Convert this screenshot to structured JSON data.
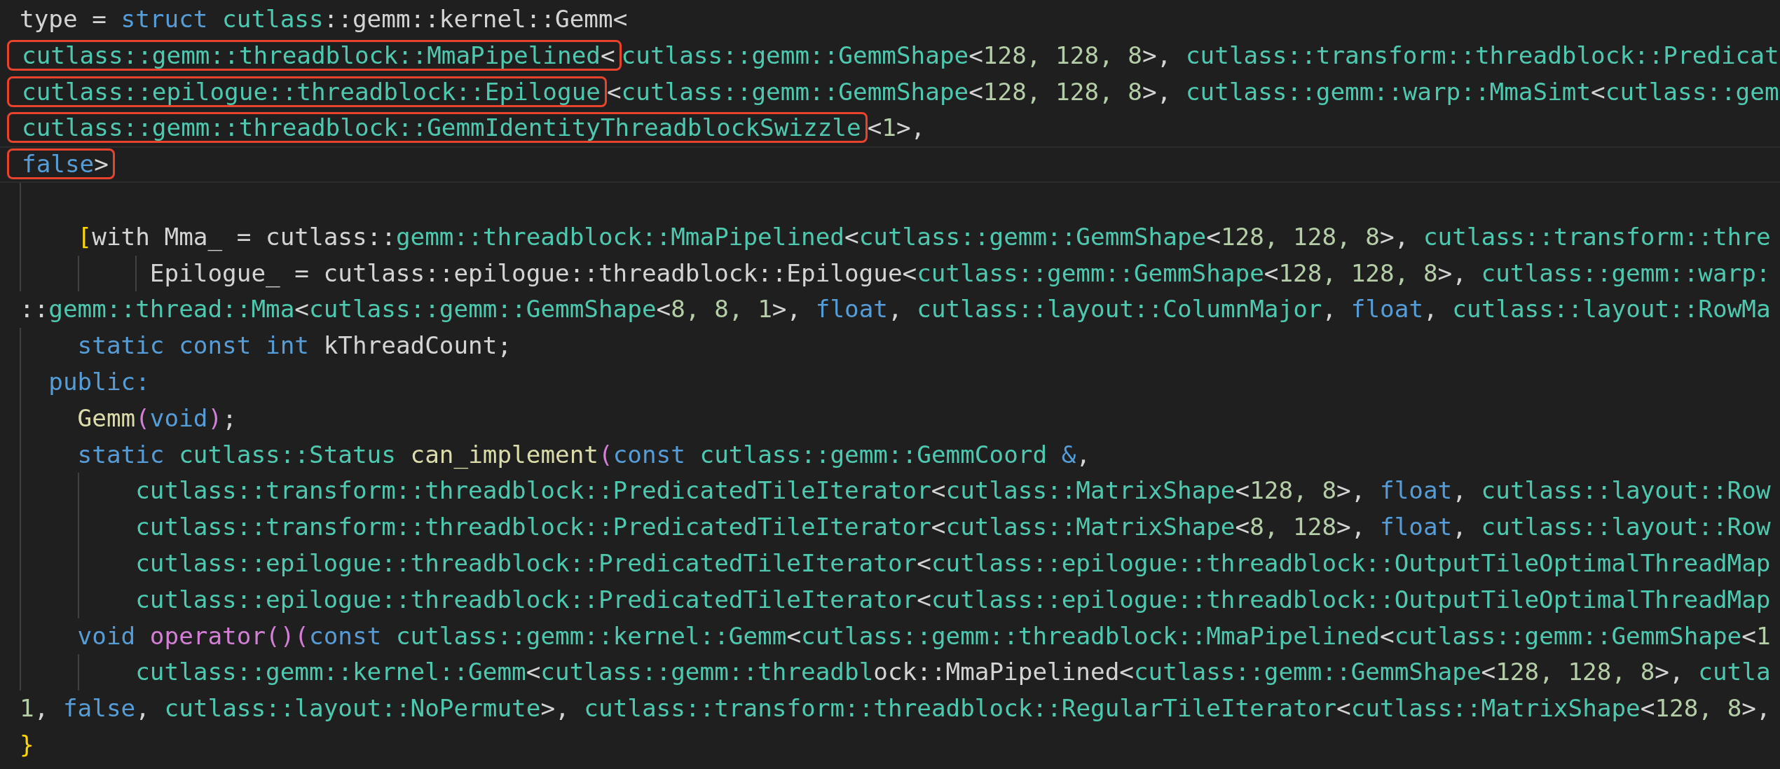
{
  "code_lines": [
    {
      "kind": "code",
      "tokens": [
        {
          "kind": "plain",
          "text": "type = "
        },
        {
          "kind": "keyword",
          "text": "struct"
        },
        {
          "kind": "type",
          "text": " cutlass"
        },
        {
          "kind": "plain",
          "text": "::gemm::kernel::Gemm<"
        }
      ]
    },
    {
      "kind": "code",
      "tokens": [
        {
          "kind": "annotation",
          "tokens": [
            {
              "kind": "type",
              "text": "cutlass::gemm::threadblock::MmaPipelined"
            },
            {
              "kind": "plain",
              "text": "<"
            }
          ]
        },
        {
          "kind": "type",
          "text": "cutlass::gemm::GemmShape"
        },
        {
          "kind": "plain",
          "text": "<"
        },
        {
          "kind": "number",
          "text": "128, 128, 8"
        },
        {
          "kind": "plain",
          "text": ">, "
        },
        {
          "kind": "type",
          "text": "cutlass::transform::threadblock::Predicat"
        }
      ]
    },
    {
      "kind": "code",
      "tokens": [
        {
          "kind": "annotation",
          "tokens": [
            {
              "kind": "type",
              "text": "cutlass::epilogue::threadblock::Epilogue"
            }
          ]
        },
        {
          "kind": "plain",
          "text": "<"
        },
        {
          "kind": "type",
          "text": "cutlass::gemm::GemmShape"
        },
        {
          "kind": "plain",
          "text": "<"
        },
        {
          "kind": "number",
          "text": "128, 128, 8"
        },
        {
          "kind": "plain",
          "text": ">, "
        },
        {
          "kind": "type",
          "text": "cutlass::gemm::warp::MmaSimt"
        },
        {
          "kind": "plain",
          "text": "<"
        },
        {
          "kind": "type",
          "text": "cutlass::gem"
        }
      ]
    },
    {
      "kind": "code",
      "tokens": [
        {
          "kind": "annotation",
          "tokens": [
            {
              "kind": "type",
              "text": "cutlass::gemm::threadblock::GemmIdentityThreadblockSwizzle"
            }
          ]
        },
        {
          "kind": "plain",
          "text": "<"
        },
        {
          "kind": "number",
          "text": "1"
        },
        {
          "kind": "plain",
          "text": ">,"
        }
      ]
    },
    {
      "kind": "code",
      "current": true,
      "tokens": [
        {
          "kind": "annotation",
          "tokens": [
            {
              "kind": "keyword",
              "text": "false"
            },
            {
              "kind": "plain",
              "text": ">"
            }
          ]
        }
      ]
    },
    {
      "kind": "blank"
    },
    {
      "kind": "code",
      "tokens": [
        {
          "kind": "brace",
          "text": "    ["
        },
        {
          "kind": "plain",
          "text": "with Mma_ = cutlass::"
        },
        {
          "kind": "type",
          "text": "gemm::threadblock::MmaPipelined"
        },
        {
          "kind": "plain",
          "text": "<"
        },
        {
          "kind": "type",
          "text": "cutlass::gemm::GemmShape"
        },
        {
          "kind": "plain",
          "text": "<"
        },
        {
          "kind": "number",
          "text": "128, 128, 8"
        },
        {
          "kind": "plain",
          "text": ">, "
        },
        {
          "kind": "type",
          "text": "cutlass::transform::thre"
        }
      ]
    },
    {
      "kind": "code",
      "tokens": [
        {
          "kind": "plain",
          "text": "         Epilogue_ = cutlass::epilogue::threadblock::Epilogue<"
        },
        {
          "kind": "type",
          "text": "cutlass::gemm::GemmShape"
        },
        {
          "kind": "plain",
          "text": "<"
        },
        {
          "kind": "number",
          "text": "128, 128, 8"
        },
        {
          "kind": "plain",
          "text": ">, "
        },
        {
          "kind": "type",
          "text": "cutlass::gemm::warp:"
        }
      ]
    },
    {
      "kind": "code",
      "tokens": [
        {
          "kind": "plain",
          "text": "::"
        },
        {
          "kind": "type",
          "text": "gemm::thread::Mma"
        },
        {
          "kind": "plain",
          "text": "<"
        },
        {
          "kind": "type",
          "text": "cutlass::gemm::GemmShape"
        },
        {
          "kind": "plain",
          "text": "<"
        },
        {
          "kind": "number",
          "text": "8, 8, 1"
        },
        {
          "kind": "plain",
          "text": ">, "
        },
        {
          "kind": "keyword",
          "text": "float"
        },
        {
          "kind": "plain",
          "text": ", "
        },
        {
          "kind": "type",
          "text": "cutlass::layout::ColumnMajor"
        },
        {
          "kind": "plain",
          "text": ", "
        },
        {
          "kind": "keyword",
          "text": "float"
        },
        {
          "kind": "plain",
          "text": ", "
        },
        {
          "kind": "type",
          "text": "cutlass::layout::RowMa"
        }
      ]
    },
    {
      "kind": "code",
      "tokens": [
        {
          "kind": "keyword",
          "text": "    static const int"
        },
        {
          "kind": "plain",
          "text": " kThreadCount;"
        }
      ]
    },
    {
      "kind": "code",
      "tokens": [
        {
          "kind": "keyword",
          "text": "  public:"
        }
      ]
    },
    {
      "kind": "code",
      "tokens": [
        {
          "kind": "function",
          "text": "    Gemm"
        },
        {
          "kind": "bracket",
          "text": "("
        },
        {
          "kind": "keyword",
          "text": "void"
        },
        {
          "kind": "bracket",
          "text": ")"
        },
        {
          "kind": "plain",
          "text": ";"
        }
      ]
    },
    {
      "kind": "code",
      "tokens": [
        {
          "kind": "keyword",
          "text": "    static"
        },
        {
          "kind": "type",
          "text": " cutlass::Status"
        },
        {
          "kind": "function",
          "text": " can_implement"
        },
        {
          "kind": "bracket",
          "text": "("
        },
        {
          "kind": "keyword",
          "text": "const"
        },
        {
          "kind": "type",
          "text": " cutlass::gemm::GemmCoord"
        },
        {
          "kind": "keyword",
          "text": " &"
        },
        {
          "kind": "plain",
          "text": ","
        }
      ]
    },
    {
      "kind": "code",
      "tokens": [
        {
          "kind": "type",
          "text": "        cutlass::transform::threadblock::PredicatedTileIterator"
        },
        {
          "kind": "plain",
          "text": "<"
        },
        {
          "kind": "type",
          "text": "cutlass::MatrixShape"
        },
        {
          "kind": "plain",
          "text": "<"
        },
        {
          "kind": "number",
          "text": "128, 8"
        },
        {
          "kind": "plain",
          "text": ">, "
        },
        {
          "kind": "keyword",
          "text": "float"
        },
        {
          "kind": "plain",
          "text": ", "
        },
        {
          "kind": "type",
          "text": "cutlass::layout::Row"
        }
      ]
    },
    {
      "kind": "code",
      "tokens": [
        {
          "kind": "type",
          "text": "        cutlass::transform::threadblock::PredicatedTileIterator"
        },
        {
          "kind": "plain",
          "text": "<"
        },
        {
          "kind": "type",
          "text": "cutlass::MatrixShape"
        },
        {
          "kind": "plain",
          "text": "<"
        },
        {
          "kind": "number",
          "text": "8, 128"
        },
        {
          "kind": "plain",
          "text": ">, "
        },
        {
          "kind": "keyword",
          "text": "float"
        },
        {
          "kind": "plain",
          "text": ", "
        },
        {
          "kind": "type",
          "text": "cutlass::layout::Row"
        }
      ]
    },
    {
      "kind": "code",
      "tokens": [
        {
          "kind": "type",
          "text": "        cutlass::epilogue::threadblock::PredicatedTileIterator"
        },
        {
          "kind": "plain",
          "text": "<"
        },
        {
          "kind": "type",
          "text": "cutlass::epilogue::threadblock::OutputTileOptimalThreadMap"
        }
      ]
    },
    {
      "kind": "code",
      "tokens": [
        {
          "kind": "type",
          "text": "        cutlass::epilogue::threadblock::PredicatedTileIterator"
        },
        {
          "kind": "plain",
          "text": "<"
        },
        {
          "kind": "type",
          "text": "cutlass::epilogue::threadblock::OutputTileOptimalThreadMap"
        }
      ]
    },
    {
      "kind": "code",
      "tokens": [
        {
          "kind": "keyword",
          "text": "    void"
        },
        {
          "kind": "bracket",
          "text": " operator()("
        },
        {
          "kind": "keyword",
          "text": "const"
        },
        {
          "kind": "type",
          "text": " cutlass::gemm::kernel::Gemm"
        },
        {
          "kind": "plain",
          "text": "<"
        },
        {
          "kind": "type",
          "text": "cutlass::gemm::threadblock::MmaPipelined"
        },
        {
          "kind": "plain",
          "text": "<"
        },
        {
          "kind": "type",
          "text": "cutlass::gemm::GemmShape"
        },
        {
          "kind": "plain",
          "text": "<"
        },
        {
          "kind": "number",
          "text": "1"
        }
      ]
    },
    {
      "kind": "code",
      "tokens": [
        {
          "kind": "type",
          "text": "        cutlass::gemm::kernel::Gemm"
        },
        {
          "kind": "plain",
          "text": "<"
        },
        {
          "kind": "type",
          "text": "cutlass::gemm::threadbl"
        },
        {
          "kind": "plain",
          "text": "ock::MmaPipelined<"
        },
        {
          "kind": "type",
          "text": "cutlass::gemm::GemmShape"
        },
        {
          "kind": "plain",
          "text": "<"
        },
        {
          "kind": "number",
          "text": "128, 128, 8"
        },
        {
          "kind": "plain",
          "text": ">, "
        },
        {
          "kind": "type",
          "text": "cutla"
        }
      ]
    },
    {
      "kind": "code",
      "tokens": [
        {
          "kind": "number",
          "text": "1"
        },
        {
          "kind": "plain",
          "text": ", "
        },
        {
          "kind": "keyword",
          "text": "false"
        },
        {
          "kind": "plain",
          "text": ", "
        },
        {
          "kind": "type",
          "text": "cutlass::layout::NoPermute"
        },
        {
          "kind": "plain",
          "text": ">, "
        },
        {
          "kind": "type",
          "text": "cutlass::transform::threadblock::RegularTileIterator"
        },
        {
          "kind": "plain",
          "text": "<"
        },
        {
          "kind": "type",
          "text": "cutlass::MatrixShape"
        },
        {
          "kind": "plain",
          "text": "<"
        },
        {
          "kind": "number",
          "text": "128, 8"
        },
        {
          "kind": "plain",
          "text": ">,"
        }
      ]
    },
    {
      "kind": "code",
      "tokens": [
        {
          "kind": "brace",
          "text": "}"
        }
      ]
    }
  ]
}
